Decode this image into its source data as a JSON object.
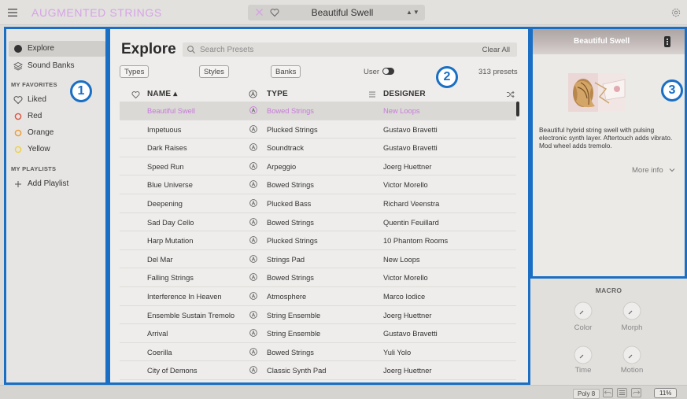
{
  "header": {
    "app_title": "AUGMENTED STRINGS",
    "current_preset": "Beautiful Swell",
    "nav_arrows": "▲▼"
  },
  "sidebar": {
    "explore": "Explore",
    "sound_banks": "Sound Banks",
    "favorites_heading": "MY FAVORITES",
    "favorites": [
      {
        "label": "Liked",
        "color": "#555555"
      },
      {
        "label": "Red",
        "color": "#e0503a"
      },
      {
        "label": "Orange",
        "color": "#ef9a2e"
      },
      {
        "label": "Yellow",
        "color": "#efcf42"
      }
    ],
    "playlists_heading": "MY PLAYLISTS",
    "add_playlist": "Add Playlist"
  },
  "callouts": [
    "1",
    "2",
    "3"
  ],
  "main": {
    "title": "Explore",
    "search_placeholder": "Search Presets",
    "clear_all": "Clear All",
    "filters": [
      "Types",
      "Styles",
      "Banks"
    ],
    "user_label": "User",
    "preset_count": "313 presets",
    "columns": {
      "name": "NAME ▴",
      "type": "TYPE",
      "designer": "DESIGNER"
    },
    "rows": [
      {
        "name": "Beautiful Swell",
        "type": "Bowed Strings",
        "designer": "New Loops"
      },
      {
        "name": "Impetuous",
        "type": "Plucked Strings",
        "designer": "Gustavo Bravetti"
      },
      {
        "name": "Dark Raises",
        "type": "Soundtrack",
        "designer": "Gustavo Bravetti"
      },
      {
        "name": "Speed Run",
        "type": "Arpeggio",
        "designer": "Joerg Huettner"
      },
      {
        "name": "Blue Universe",
        "type": "Bowed Strings",
        "designer": "Victor Morello"
      },
      {
        "name": "Deepening",
        "type": "Plucked Bass",
        "designer": "Richard Veenstra"
      },
      {
        "name": "Sad Day Cello",
        "type": "Bowed Strings",
        "designer": "Quentin Feuillard"
      },
      {
        "name": "Harp Mutation",
        "type": "Plucked Strings",
        "designer": "10 Phantom Rooms"
      },
      {
        "name": "Del Mar",
        "type": "Strings Pad",
        "designer": "New Loops"
      },
      {
        "name": "Falling Strings",
        "type": "Bowed Strings",
        "designer": "Victor Morello"
      },
      {
        "name": "Interference In Heaven",
        "type": "Atmosphere",
        "designer": "Marco Iodice"
      },
      {
        "name": "Ensemble Sustain Tremolo",
        "type": "String Ensemble",
        "designer": "Joerg Huettner"
      },
      {
        "name": "Arrival",
        "type": "String Ensemble",
        "designer": "Gustavo Bravetti"
      },
      {
        "name": "Coerilla",
        "type": "Bowed Strings",
        "designer": "Yuli Yolo"
      },
      {
        "name": "City of Demons",
        "type": "Classic Synth Pad",
        "designer": "Joerg Huettner"
      }
    ]
  },
  "info_panel": {
    "title": "Beautiful Swell",
    "description": "Beautiful hybrid string swell with pulsing electronic synth layer. Aftertouch adds vibrato. Mod wheel adds tremolo.",
    "more_info": "More info"
  },
  "macro": {
    "title": "MACRO",
    "knobs": [
      "Color",
      "Morph",
      "Time",
      "Motion"
    ]
  },
  "status": {
    "poly": "Poly 8",
    "cpu": "11%"
  },
  "colors": {
    "accent": "#1a6fc5",
    "selected_text": "#c87ad9",
    "title_pink": "#d7a3e6"
  }
}
